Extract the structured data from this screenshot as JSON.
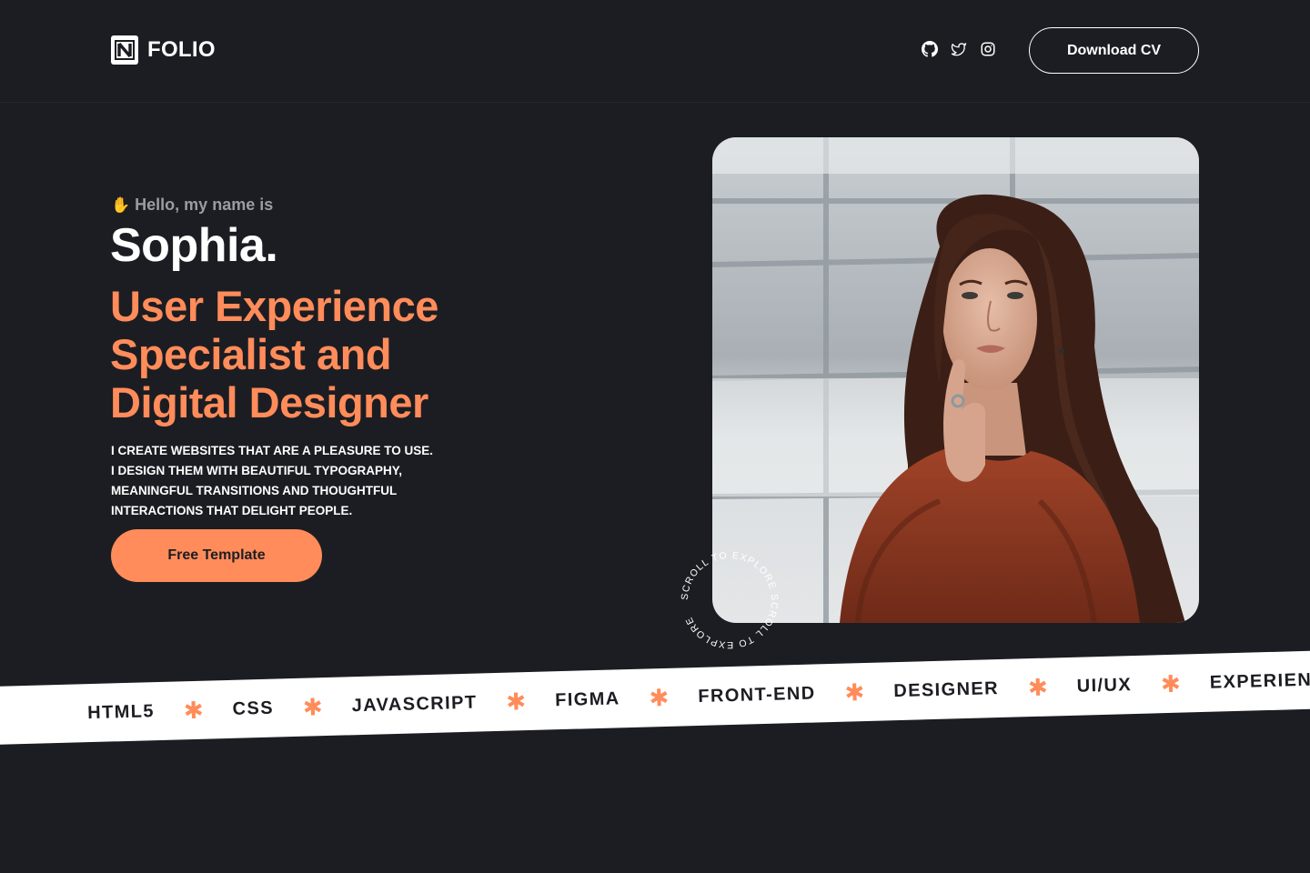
{
  "header": {
    "logo_letter": "N",
    "logo_text": "FOLIO",
    "social_icons": [
      "github-icon",
      "twitter-icon",
      "instagram-icon"
    ],
    "cv_button_label": "Download CV"
  },
  "hero": {
    "greeting_icon": "hand-icon",
    "greeting": "Hello, my name is",
    "name": "Sophia.",
    "headline_lines": [
      "User Experience",
      "Specialist and",
      "Digital Designer"
    ],
    "description_lines": [
      "I CREATE WEBSITES THAT ARE A PLEASURE TO USE.",
      "I DESIGN THEM WITH BEAUTIFUL TYPOGRAPHY,",
      "MEANINGFUL TRANSITIONS AND THOUGHTFUL",
      "INTERACTIONS THAT DELIGHT PEOPLE."
    ],
    "cta_label": "Free Template",
    "scroll_badge_text": "SCROLL TO EXPLORE SCROLL TO EXPLORE "
  },
  "ribbon": {
    "skills": [
      "HTML5",
      "CSS",
      "JAVASCRIPT",
      "FIGMA",
      "FRONT-END",
      "DESIGNER",
      "UI/UX",
      "EXPERIENCES"
    ],
    "separator": "✱"
  },
  "colors": {
    "background": "#1c1d22",
    "accent": "#ff8c5a",
    "text": "#ffffff",
    "muted": "#9b9ca3"
  }
}
